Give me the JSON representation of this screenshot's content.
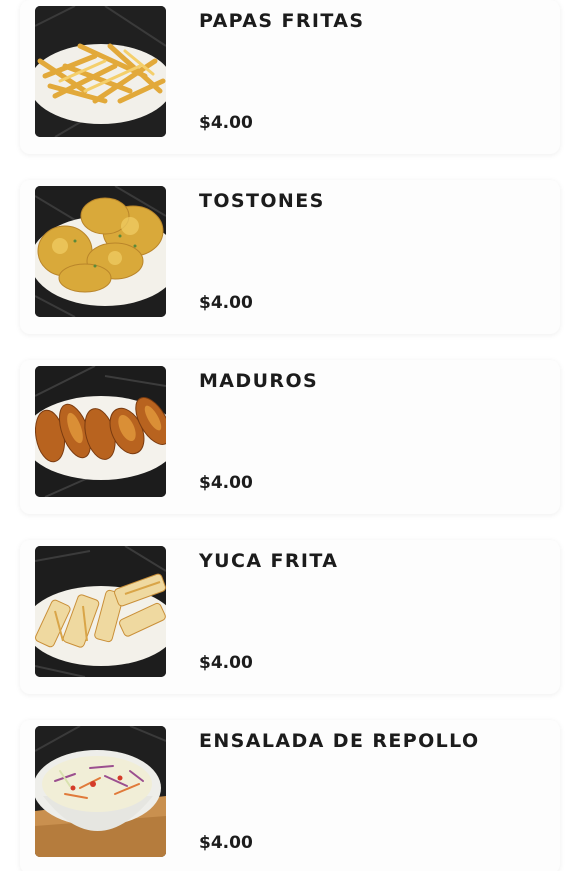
{
  "menu": {
    "items": [
      {
        "name": "PAPAS FRITAS",
        "price": "$4.00",
        "image_icon": "french-fries-image"
      },
      {
        "name": "TOSTONES",
        "price": "$4.00",
        "image_icon": "tostones-image"
      },
      {
        "name": "MADUROS",
        "price": "$4.00",
        "image_icon": "maduros-image"
      },
      {
        "name": "YUCA FRITA",
        "price": "$4.00",
        "image_icon": "yuca-frita-image"
      },
      {
        "name": "ENSALADA DE REPOLLO",
        "price": "$4.00",
        "image_icon": "coleslaw-image"
      }
    ]
  },
  "colors": {
    "text": "#1c1c1c",
    "card_bg": "#fdfdfd",
    "page_bg": "#ffffff"
  }
}
